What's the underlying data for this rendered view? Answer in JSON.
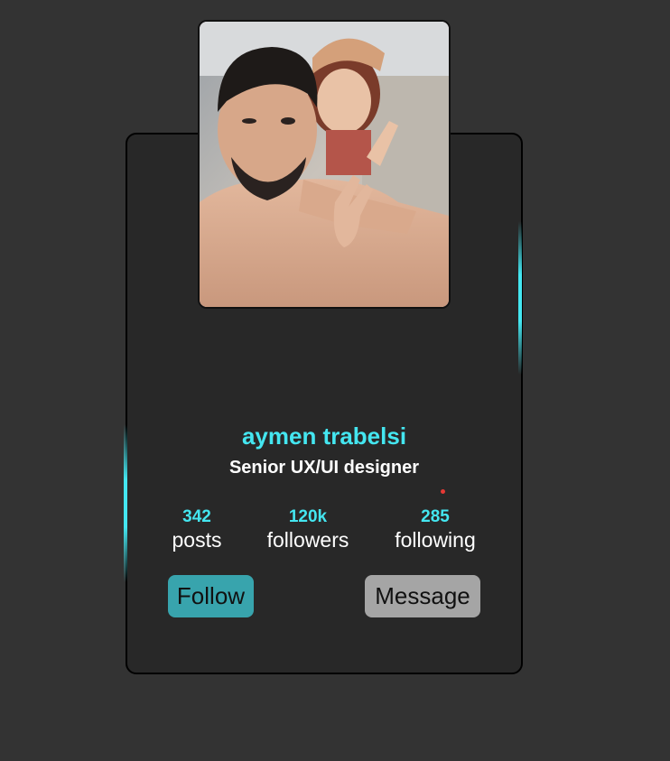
{
  "profile": {
    "name": "aymen trabelsi",
    "title": "Senior UX/UI designer",
    "photo_alt": "profile photo"
  },
  "stats": [
    {
      "value": "342",
      "label": "posts"
    },
    {
      "value": "120k",
      "label": "followers"
    },
    {
      "value": "285",
      "label": "following"
    }
  ],
  "actions": {
    "follow_label": "Follow",
    "message_label": "Message"
  },
  "colors": {
    "background": "#333333",
    "card": "#282828",
    "accent": "#44e6f0",
    "follow_button": "#38a4ad",
    "message_button": "#a5a5a5",
    "photo_border_accent": "#c2185b"
  }
}
